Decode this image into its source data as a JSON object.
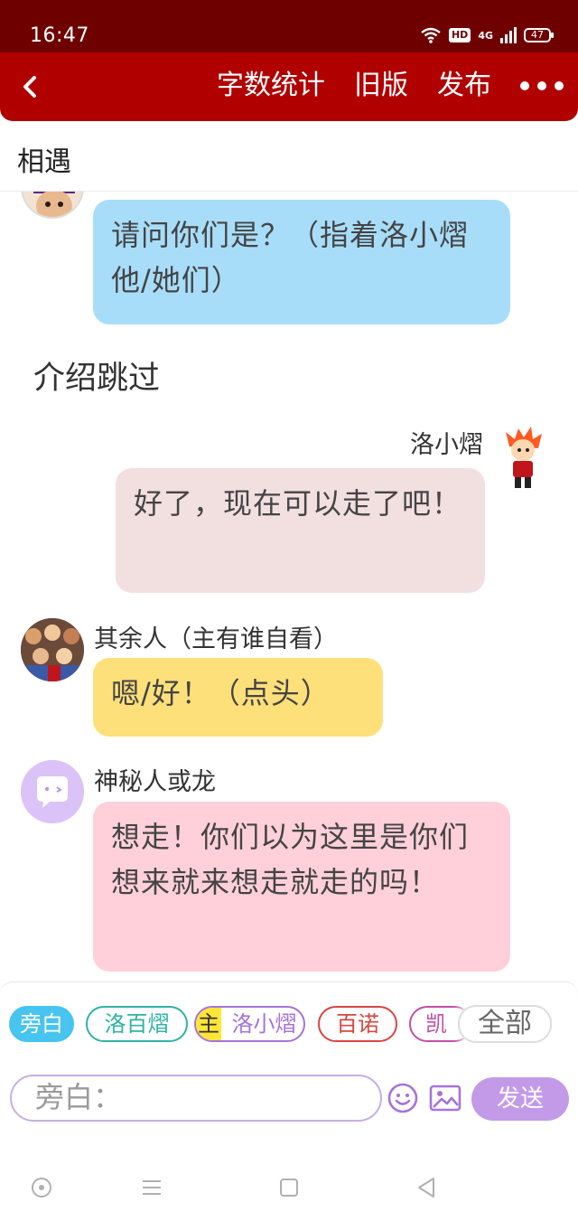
{
  "status_bar": {
    "time": "16:47",
    "network": "4G",
    "hd": "HD",
    "battery": "47"
  },
  "app_bar": {
    "menu": [
      "字数统计",
      "旧版",
      "发布"
    ]
  },
  "page": {
    "title": "相遇"
  },
  "messages": [
    {
      "speaker": "",
      "text": "请问你们是？（指着洛小熠他/她们）",
      "color": "#a8ddf9"
    },
    {
      "type": "narration",
      "text": "介绍跳过"
    },
    {
      "speaker": "洛小熠",
      "text": "好了，现在可以走了吧！",
      "color": "#f2dfdf"
    },
    {
      "speaker": "其余人（主有谁自看）",
      "text": "嗯/好！（点头）",
      "color": "#fde07a"
    },
    {
      "speaker": "神秘人或龙",
      "text": "想走！你们以为这里是你们想来就来想走就走的吗！",
      "color": "#ffd0da"
    }
  ],
  "role_chips": [
    {
      "label": "旁白",
      "color": "#47c4ef"
    },
    {
      "label": "洛百熠",
      "color": "#2fb3a5"
    },
    {
      "tag": "主",
      "label": "洛小熠",
      "color": "#a773d8"
    },
    {
      "label": "百诺",
      "color": "#d6473f"
    },
    {
      "label": "凯",
      "color": "#c24fa6"
    },
    {
      "label": "全部"
    }
  ],
  "composer": {
    "placeholder": "旁白：",
    "send_label": "发送"
  }
}
